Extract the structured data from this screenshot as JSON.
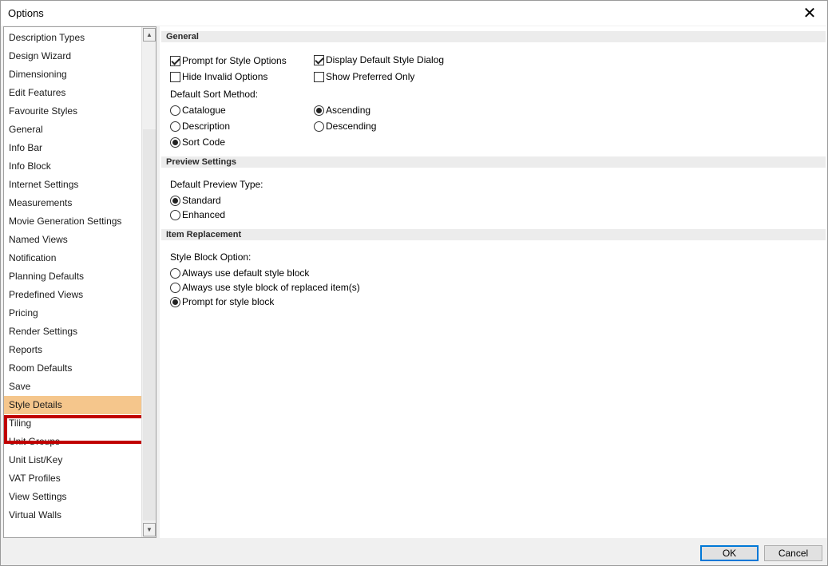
{
  "window": {
    "title": "Options",
    "close_glyph": "✕"
  },
  "nav": {
    "items": [
      "Description Types",
      "Design Wizard",
      "Dimensioning",
      "Edit Features",
      "Favourite Styles",
      "General",
      "Info Bar",
      "Info Block",
      "Internet Settings",
      "Measurements",
      "Movie Generation Settings",
      "Named Views",
      "Notification",
      "Planning Defaults",
      "Predefined Views",
      "Pricing",
      "Render Settings",
      "Reports",
      "Room Defaults",
      "Save",
      "Style Details",
      "Tiling",
      "Unit Groups",
      "Unit List/Key",
      "VAT Profiles",
      "View Settings",
      "Virtual Walls"
    ],
    "selected_index": 20,
    "selected_color": "#f5c68c",
    "highlight_color": "#c00000",
    "scroll_up_glyph": "▲",
    "scroll_down_glyph": "▼"
  },
  "general": {
    "header": "General",
    "prompt_style_options": {
      "label": "Prompt for Style Options",
      "checked": true
    },
    "display_default_style_dialog": {
      "label": "Display Default Style Dialog",
      "checked": true
    },
    "hide_invalid_options": {
      "label": "Hide Invalid Options",
      "checked": false
    },
    "show_preferred_only": {
      "label": "Show Preferred Only",
      "checked": false
    },
    "sort_method_label": "Default Sort Method:",
    "sort_catalogue": {
      "label": "Catalogue",
      "checked": false
    },
    "sort_description": {
      "label": "Description",
      "checked": false
    },
    "sort_code": {
      "label": "Sort Code",
      "checked": true
    },
    "order_ascending": {
      "label": "Ascending",
      "checked": true
    },
    "order_descending": {
      "label": "Descending",
      "checked": false
    }
  },
  "preview": {
    "header": "Preview Settings",
    "type_label": "Default Preview Type:",
    "standard": {
      "label": "Standard",
      "checked": true
    },
    "enhanced": {
      "label": "Enhanced",
      "checked": false
    }
  },
  "replacement": {
    "header": "Item Replacement",
    "option_label": "Style Block Option:",
    "always_default": {
      "label": "Always use default style block",
      "checked": false
    },
    "always_replaced": {
      "label": "Always use style block of replaced item(s)",
      "checked": false
    },
    "prompt_block": {
      "label": "Prompt for style block",
      "checked": true
    }
  },
  "buttons": {
    "ok": "OK",
    "cancel": "Cancel"
  }
}
